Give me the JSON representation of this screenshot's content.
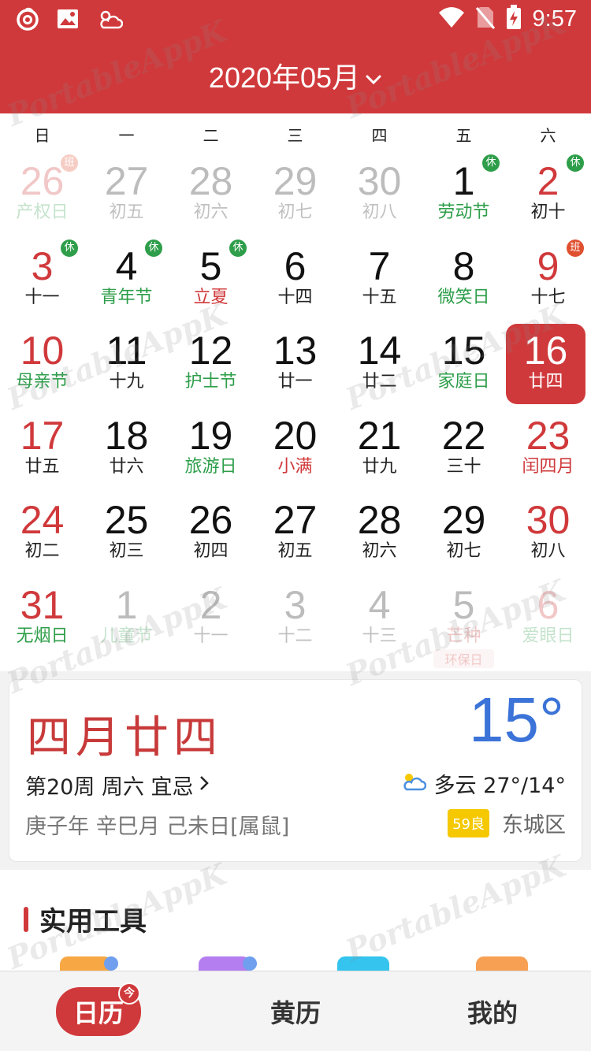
{
  "status_bar": {
    "time": "9:57"
  },
  "header": {
    "month_title": "2020年05月"
  },
  "weekdays": [
    "日",
    "一",
    "二",
    "三",
    "四",
    "五",
    "六"
  ],
  "weeks": [
    [
      {
        "day": "26",
        "sub": "产权日",
        "tag": "班",
        "dim": true,
        "day_color": "red",
        "sub_color": "green"
      },
      {
        "day": "27",
        "sub": "初五",
        "dim": true
      },
      {
        "day": "28",
        "sub": "初六",
        "dim": true
      },
      {
        "day": "29",
        "sub": "初七",
        "dim": true
      },
      {
        "day": "30",
        "sub": "初八",
        "dim": true
      },
      {
        "day": "1",
        "sub": "劳动节",
        "tag": "休",
        "sub_color": "green"
      },
      {
        "day": "2",
        "sub": "初十",
        "tag": "休",
        "day_color": "red"
      }
    ],
    [
      {
        "day": "3",
        "sub": "十一",
        "tag": "休",
        "day_color": "red"
      },
      {
        "day": "4",
        "sub": "青年节",
        "tag": "休",
        "sub_color": "green"
      },
      {
        "day": "5",
        "sub": "立夏",
        "tag": "休",
        "sub_color": "red"
      },
      {
        "day": "6",
        "sub": "十四"
      },
      {
        "day": "7",
        "sub": "十五"
      },
      {
        "day": "8",
        "sub": "微笑日",
        "sub_color": "green"
      },
      {
        "day": "9",
        "sub": "十七",
        "tag": "班",
        "day_color": "red"
      }
    ],
    [
      {
        "day": "10",
        "sub": "母亲节",
        "day_color": "red",
        "sub_color": "green"
      },
      {
        "day": "11",
        "sub": "十九"
      },
      {
        "day": "12",
        "sub": "护士节",
        "sub_color": "green"
      },
      {
        "day": "13",
        "sub": "廿一"
      },
      {
        "day": "14",
        "sub": "廿二"
      },
      {
        "day": "15",
        "sub": "家庭日",
        "sub_color": "green"
      },
      {
        "day": "16",
        "sub": "廿四",
        "selected": true
      }
    ],
    [
      {
        "day": "17",
        "sub": "廿五",
        "day_color": "red"
      },
      {
        "day": "18",
        "sub": "廿六"
      },
      {
        "day": "19",
        "sub": "旅游日",
        "sub_color": "green"
      },
      {
        "day": "20",
        "sub": "小满",
        "sub_color": "red"
      },
      {
        "day": "21",
        "sub": "廿九"
      },
      {
        "day": "22",
        "sub": "三十"
      },
      {
        "day": "23",
        "sub": "闰四月",
        "day_color": "red",
        "sub_color": "red"
      }
    ],
    [
      {
        "day": "24",
        "sub": "初二",
        "day_color": "red"
      },
      {
        "day": "25",
        "sub": "初三"
      },
      {
        "day": "26",
        "sub": "初四"
      },
      {
        "day": "27",
        "sub": "初五"
      },
      {
        "day": "28",
        "sub": "初六"
      },
      {
        "day": "29",
        "sub": "初七"
      },
      {
        "day": "30",
        "sub": "初八",
        "day_color": "red"
      }
    ],
    [
      {
        "day": "31",
        "sub": "无烟日",
        "day_color": "red",
        "sub_color": "green"
      },
      {
        "day": "1",
        "sub": "儿童节",
        "dim": true,
        "sub_color": "green"
      },
      {
        "day": "2",
        "sub": "十一",
        "dim": true
      },
      {
        "day": "3",
        "sub": "十二",
        "dim": true
      },
      {
        "day": "4",
        "sub": "十三",
        "dim": true
      },
      {
        "day": "5",
        "sub": "芒种",
        "extra": "环保日",
        "dim": true,
        "sub_color": "red"
      },
      {
        "day": "6",
        "sub": "爱眼日",
        "dim": true,
        "day_color": "red",
        "sub_color": "green"
      }
    ]
  ],
  "info": {
    "lunar_date": "四月廿四",
    "temperature": "15°",
    "week_info": "第20周 周六 宜忌",
    "ganzhi": "庚子年 辛巳月 己未日[属鼠]",
    "weather": "多云 27°/14°",
    "aqi": "59良",
    "district": "东城区"
  },
  "tools": {
    "title": "实用工具"
  },
  "nav": [
    {
      "label": "日历",
      "active": true,
      "badge": "今"
    },
    {
      "label": "黄历"
    },
    {
      "label": "我的"
    }
  ],
  "watermark": "PortableAppK",
  "colors": {
    "brand": "#d0393b",
    "holiday_green": "#2e9e4a",
    "temp_blue": "#3b73d8"
  }
}
